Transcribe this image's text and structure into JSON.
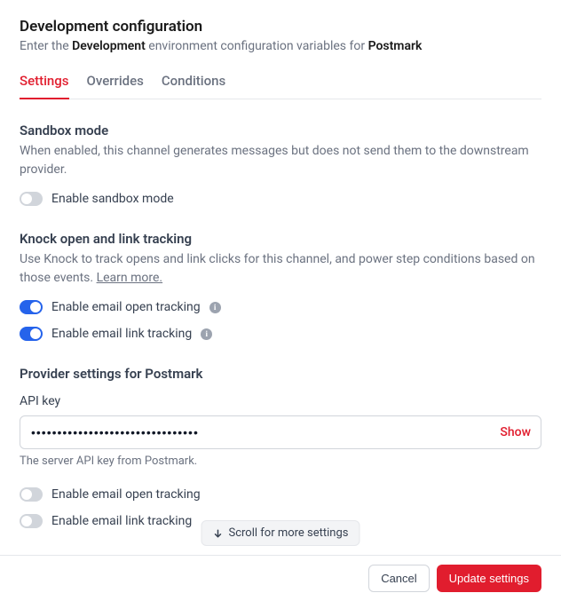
{
  "header": {
    "title": "Development configuration",
    "subtitle_prefix": "Enter the ",
    "subtitle_env": "Development",
    "subtitle_mid": " environment configuration variables for ",
    "subtitle_provider": "Postmark"
  },
  "tabs": [
    {
      "label": "Settings",
      "active": true
    },
    {
      "label": "Overrides",
      "active": false
    },
    {
      "label": "Conditions",
      "active": false
    }
  ],
  "sandbox": {
    "title": "Sandbox mode",
    "desc": "When enabled, this channel generates messages but does not send them to the downstream provider.",
    "toggle_label": "Enable sandbox mode",
    "enabled": false
  },
  "tracking": {
    "title": "Knock open and link tracking",
    "desc": "Use Knock to track opens and link clicks for this channel, and power step conditions based on those events. ",
    "learn_more": "Learn more.",
    "open_label": "Enable email open tracking",
    "open_enabled": true,
    "link_label": "Enable email link tracking",
    "link_enabled": true
  },
  "provider": {
    "title": "Provider settings for Postmark",
    "api_key_label": "API key",
    "api_key_value": "••••••••••••••••••••••••••••••••",
    "show_label": "Show",
    "api_key_help": "The server API key from Postmark.",
    "open_label": "Enable email open tracking",
    "open_enabled": false,
    "link_label": "Enable email link tracking",
    "link_enabled": false
  },
  "scroll_hint": "Scroll for more settings",
  "footer": {
    "cancel": "Cancel",
    "update": "Update settings"
  }
}
